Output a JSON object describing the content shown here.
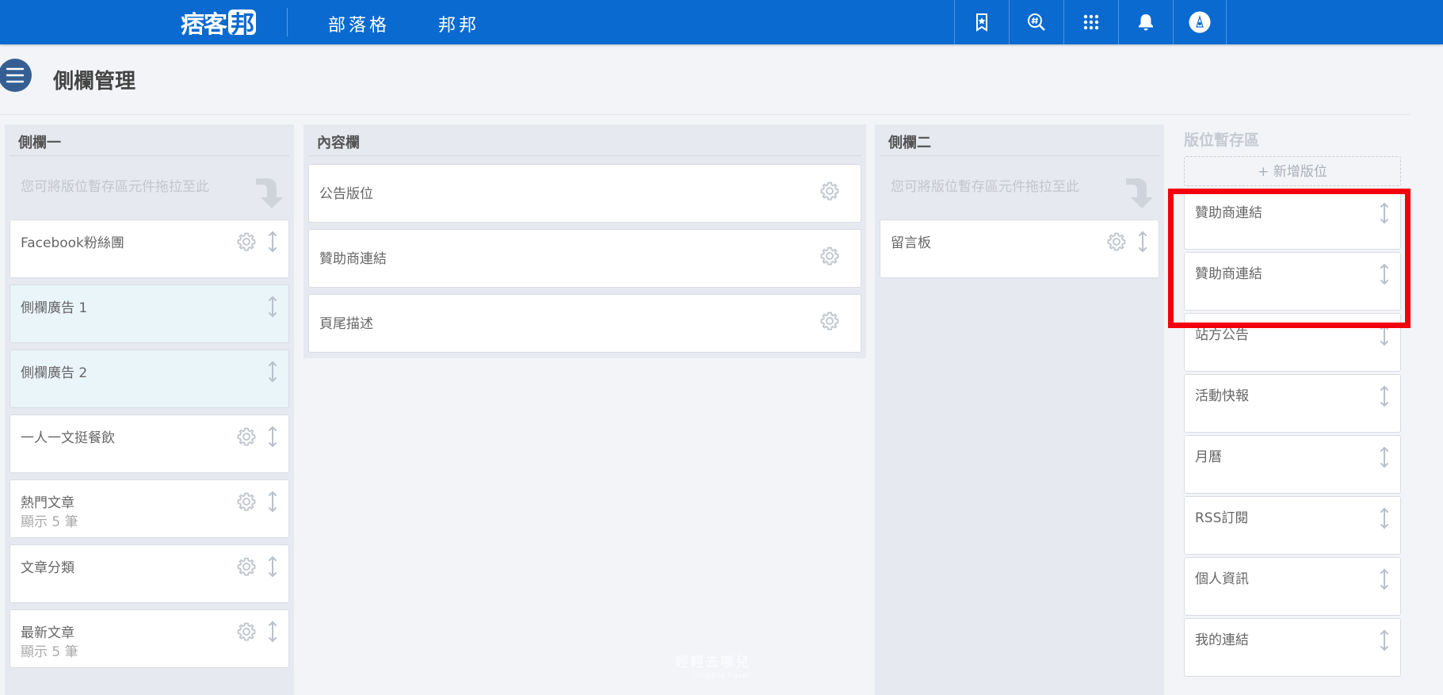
{
  "topbar": {
    "logo_text": "痞客",
    "logo_box_text": "邦",
    "nav": [
      "部落格",
      "邦邦"
    ],
    "icons": [
      "bookmark-star-icon",
      "hashtag-search-icon",
      "apps-grid-icon",
      "bell-icon",
      "avatar-icon"
    ]
  },
  "page": {
    "title": "側欄管理"
  },
  "sidebar1": {
    "title": "側欄一",
    "drop_hint": "您可將版位暫存區元件拖拉至此",
    "items": [
      {
        "title": "Facebook粉絲團",
        "sub": "",
        "gear": true,
        "ad": false
      },
      {
        "title": "側欄廣告 1",
        "sub": "",
        "gear": false,
        "ad": true
      },
      {
        "title": "側欄廣告 2",
        "sub": "",
        "gear": false,
        "ad": true
      },
      {
        "title": "一人一文挺餐飲",
        "sub": "",
        "gear": true,
        "ad": false
      },
      {
        "title": "熱門文章",
        "sub": "顯示 5 筆",
        "gear": true,
        "ad": false
      },
      {
        "title": "文章分類",
        "sub": "",
        "gear": true,
        "ad": false
      },
      {
        "title": "最新文章",
        "sub": "顯示 5 筆",
        "gear": true,
        "ad": false
      }
    ]
  },
  "content": {
    "title": "內容欄",
    "items": [
      {
        "title": "公告版位"
      },
      {
        "title": "贊助商連結"
      },
      {
        "title": "頁尾描述"
      }
    ]
  },
  "sidebar2": {
    "title": "側欄二",
    "drop_hint": "您可將版位暫存區元件拖拉至此",
    "items": [
      {
        "title": "留言板",
        "sub": "",
        "gear": true,
        "ad": false
      }
    ]
  },
  "storage": {
    "title": "版位暫存區",
    "add_label": "+ 新增版位",
    "items": [
      {
        "title": "贊助商連結"
      },
      {
        "title": "贊助商連結"
      },
      {
        "title": "站方公告"
      },
      {
        "title": "活動快報"
      },
      {
        "title": "月曆"
      },
      {
        "title": "RSS訂閱"
      },
      {
        "title": "個人資訊"
      },
      {
        "title": "我的連結"
      }
    ]
  },
  "watermark": {
    "text": "輕輕去哪兒",
    "sub": "Qingqing Travel"
  },
  "colors": {
    "topbar": "#0a6ad0",
    "highlight": "#f4000d",
    "ad_card": "#eaf5fa"
  }
}
